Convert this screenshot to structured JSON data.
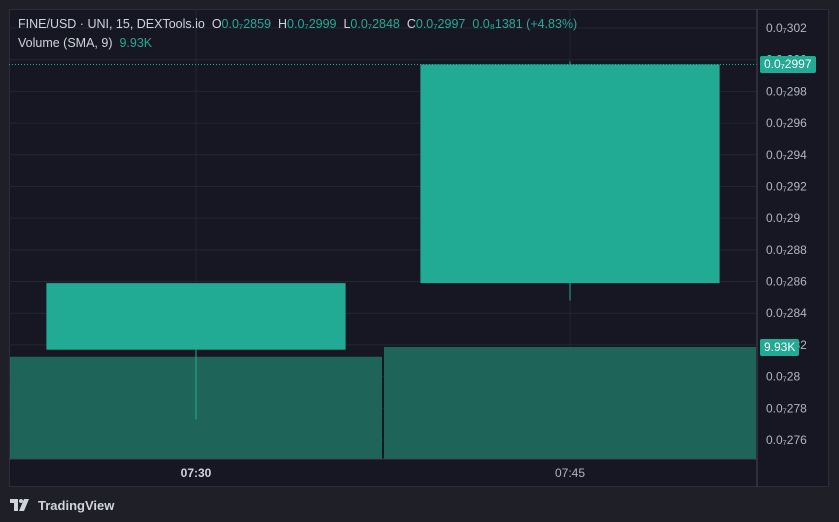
{
  "legend": {
    "symbol": "FINE/USD · UNI, 15, DEXTools.io",
    "open_label": "O",
    "open": "0.0₇2859",
    "high_label": "H",
    "high": "0.0₇2999",
    "low_label": "L",
    "low": "0.0₇2848",
    "close_label": "C",
    "close": "0.0₇2997",
    "change": "0.0₈1381 (+4.83%)",
    "volume_label": "Volume (SMA, 9)",
    "volume_value": "9.93K"
  },
  "badges": {
    "price": "0.0₇2997",
    "volume": "9.93K"
  },
  "brand": {
    "name": "TradingView"
  },
  "colors": {
    "background": "#161722",
    "up": "#22ab94",
    "volume": "#1f6459",
    "grid": "#232633",
    "text": "#b2b5be"
  },
  "chart_data": {
    "type": "candlestick",
    "x": [
      "07:30",
      "07:45"
    ],
    "candles": [
      {
        "time": "07:30",
        "open": 0.2817,
        "high": 0.2817,
        "low": 0.2773,
        "close": 0.2859
      },
      {
        "time": "07:45",
        "open": 0.2859,
        "high": 0.2999,
        "low": 0.2848,
        "close": 0.2997
      }
    ],
    "volume_series": [
      {
        "time": "07:30",
        "value": 0.63
      },
      {
        "time": "07:45",
        "value": 0.69
      }
    ],
    "yticks": [
      "0.0₇302",
      "0.0₇300",
      "0.0₇298",
      "0.0₇296",
      "0.0₇294",
      "0.0₇292",
      "0.0₇29",
      "0.0₇288",
      "0.0₇286",
      "0.0₇284",
      "0.0₇282",
      "0.0₇28",
      "0.0₇278",
      "0.0₇276"
    ],
    "ytick_values": [
      0.302,
      0.3,
      0.298,
      0.296,
      0.294,
      0.292,
      0.29,
      0.288,
      0.286,
      0.284,
      0.282,
      0.28,
      0.278,
      0.276
    ],
    "xticks": [
      "07:30",
      "07:45"
    ],
    "ylim": [
      0.2748,
      0.3032
    ],
    "last_price": 0.2997
  }
}
